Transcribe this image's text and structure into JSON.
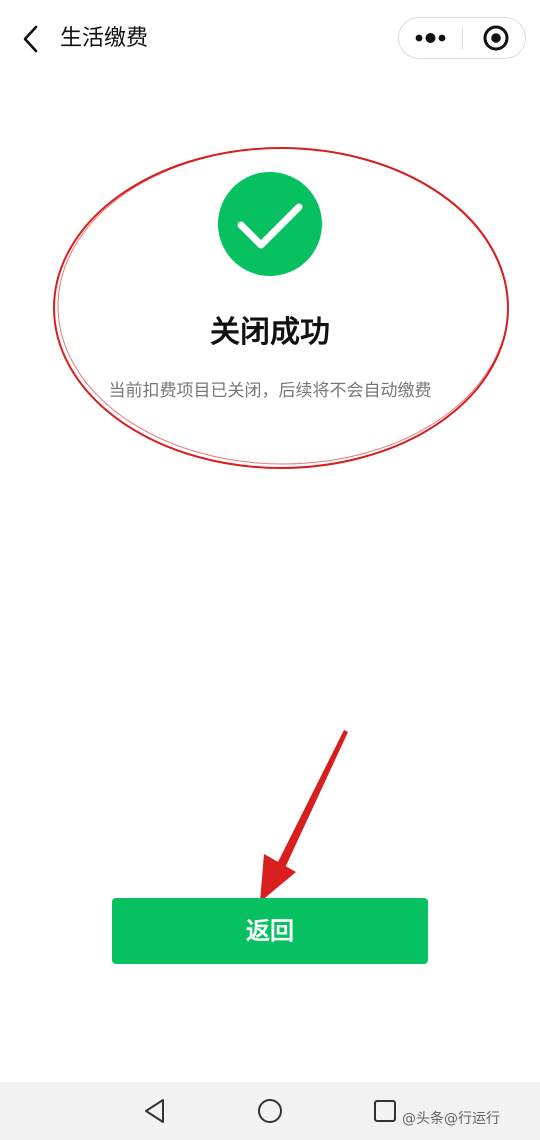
{
  "header": {
    "title": "生活缴费",
    "back_icon": "chevron-left-icon",
    "more_icon": "more-dots-icon",
    "close_icon": "target-circle-icon"
  },
  "result": {
    "icon": "check-circle-icon",
    "icon_color": "#07c160",
    "title": "关闭成功",
    "description": "当前扣费项目已关闭，后续将不会自动缴费",
    "annotation_color": "#d81e1e"
  },
  "actions": {
    "return_label": "返回",
    "return_color": "#07c160"
  },
  "nav_bar": {
    "back_icon": "triangle-back-icon",
    "home_icon": "circle-home-icon",
    "recent_icon": "square-recent-icon"
  },
  "watermark": {
    "text": "@头条@行运行"
  }
}
